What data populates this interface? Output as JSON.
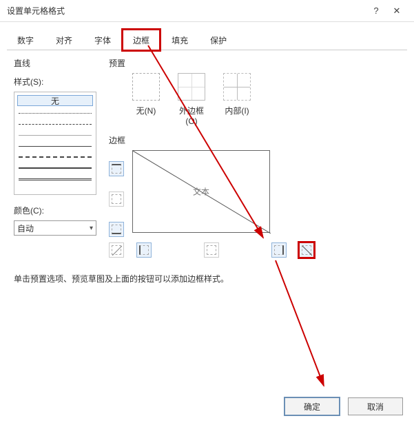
{
  "title": "设置单元格格式",
  "sys": {
    "help": "?",
    "close": "✕"
  },
  "tabs": [
    "数字",
    "对齐",
    "字体",
    "边框",
    "填充",
    "保护"
  ],
  "activeTab": 3,
  "left": {
    "line_label": "直线",
    "style_label": "样式(S):",
    "none": "无",
    "color_label": "颜色(C):",
    "color_value": "自动"
  },
  "right": {
    "preset_label": "预置",
    "presets": [
      "无(N)",
      "外边框(O)",
      "内部(I)"
    ],
    "border_label": "边框",
    "preview_text": "文本"
  },
  "hint": "单击预置选项、预览草图及上面的按钮可以添加边框样式。",
  "buttons": {
    "ok": "确定",
    "cancel": "取消"
  }
}
